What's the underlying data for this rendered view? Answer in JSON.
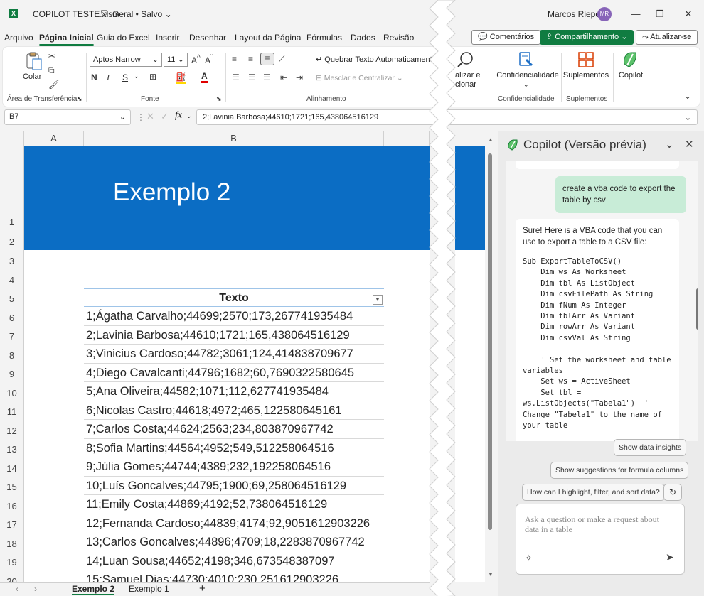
{
  "title_bar": {
    "logo": "X",
    "file_name": "COPILOT TESTE.xlsm",
    "sensitivity": "Geral • Salvo",
    "user_name": "Marcos Rieper",
    "user_initials": "MR"
  },
  "tabs": [
    "Arquivo",
    "Página Inicial",
    "Guia do Excel",
    "Inserir",
    "Desenhar",
    "Layout da Página",
    "Fórmulas",
    "Dados",
    "Revisão"
  ],
  "ribbon_buttons": {
    "comments": "Comentários",
    "share": "Compartilhamento",
    "catch_up": "Atualizar-se"
  },
  "ribbon": {
    "paste_label": "Colar",
    "clipboard_group": "Área de Transferência",
    "font_name": "Aptos Narrow",
    "font_size": "11",
    "bold": "N",
    "italic": "I",
    "underline": "S",
    "font_group": "Fonte",
    "wrap_text": "Quebrar Texto Automaticamente",
    "merge_center": "Mesclar e Centralizar",
    "alignment_group": "Alinhamento",
    "analyze_partial": "alizar e\ncionar",
    "sensitivity_label": "Confidencialidade",
    "sensitivity_group": "Confidencialidade",
    "addins_label": "Suplementos",
    "addins_group": "Suplementos",
    "copilot_label": "Copilot"
  },
  "formula_bar": {
    "name_box": "B7",
    "formula": "2;Lavinia Barbosa;44610;1721;165,438064516129"
  },
  "grid": {
    "columns": [
      "A",
      "B"
    ],
    "rows": [
      "1",
      "2",
      "3",
      "4",
      "5",
      "6",
      "7",
      "8",
      "9",
      "10",
      "11",
      "12",
      "13",
      "14",
      "15",
      "16",
      "17",
      "18",
      "19",
      "20"
    ],
    "banner_title": "Exemplo 2",
    "table_header": "Texto",
    "table_rows": [
      "1;Ágatha Carvalho;44699;2570;173,267741935484",
      "2;Lavinia Barbosa;44610;1721;165,438064516129",
      "3;Vinicius Cardoso;44782;3061;124,414838709677",
      "4;Diego Cavalcanti;44796;1682;60,7690322580645",
      "5;Ana Oliveira;44582;1071;112,627741935484",
      "6;Nicolas Castro;44618;4972;465,122580645161",
      "7;Carlos Costa;44624;2563;234,803870967742",
      "8;Sofia Martins;44564;4952;549,512258064516",
      "9;Júlia Gomes;44744;4389;232,192258064516",
      "10;Luís Goncalves;44795;1900;69,258064516129",
      "11;Emily Costa;44869;4192;52,738064516129",
      "12;Fernanda Cardoso;44839;4174;92,9051612903226",
      "13;Carlos Goncalves;44896;4709;18,2283870967742",
      "14;Luan Sousa;44652;4198;346,673548387097",
      "15;Samuel Dias;44730;4010;230,251612903226"
    ]
  },
  "sheet_tabs": [
    "Exemplo 2",
    "Exemplo 1"
  ],
  "copilot": {
    "title": "Copilot (Versão prévia)",
    "user_message": "create a vba code to export the table by csv",
    "bot_intro": "Sure! Here is a VBA code that you can use to export a table to a CSV file:",
    "bot_code": "Sub ExportTableToCSV()\n    Dim ws As Worksheet\n    Dim tbl As ListObject\n    Dim csvFilePath As String\n    Dim fNum As Integer\n    Dim tblArr As Variant\n    Dim rowArr As Variant\n    Dim csvVal As String\n\n    ' Set the worksheet and table variables\n    Set ws = ActiveSheet\n    Set tbl = ws.ListObjects(\"Tabela1\")  ' Change \"Tabela1\" to the name of your table",
    "suggestions": [
      "Show data insights",
      "Show suggestions for formula columns",
      "How can I highlight, filter, and sort data?"
    ],
    "input_placeholder": "Ask a question or make a request about data in a table"
  }
}
